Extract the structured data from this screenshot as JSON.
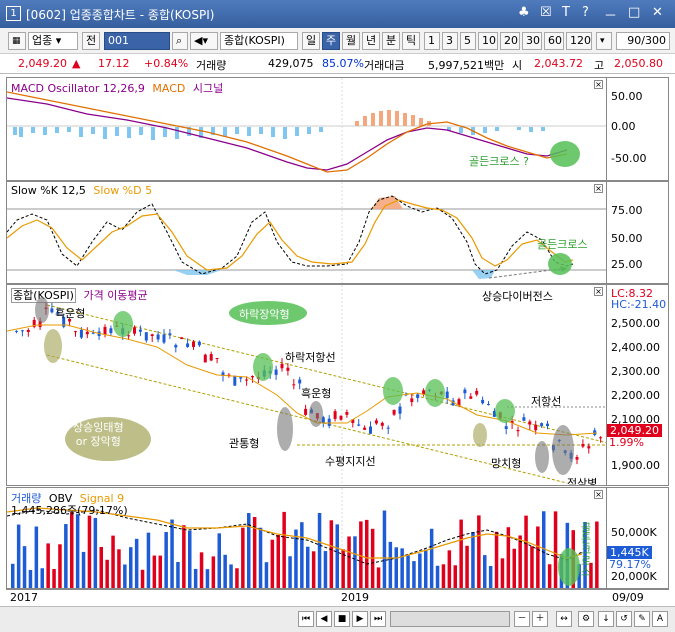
{
  "window": {
    "app_num": "1",
    "title": "[0602] 업종종합차트 - 종합(KOSPI)",
    "buttons": [
      "♣",
      "☒",
      "T",
      "?",
      "－",
      "□",
      "✕"
    ]
  },
  "toolbar": {
    "sector_select": "업종",
    "jeon_label": "전",
    "code_value": "001",
    "index_name": "종합(KOSPI)",
    "periods": [
      "일",
      "주",
      "월",
      "년",
      "분",
      "틱"
    ],
    "active_period": "주",
    "numbers": [
      "1",
      "3",
      "5",
      "10",
      "20",
      "30",
      "60",
      "120"
    ],
    "count": "90/300"
  },
  "quote": {
    "price": "2,049.20",
    "change": "17.12",
    "change_pct": "+0.84%",
    "volume_label": "거래량",
    "volume": "429,075",
    "volume_ratio": "85.07%",
    "amount_label": "거래대금",
    "amount": "5,997,521백만",
    "open_label": "시",
    "open": "2,043.72",
    "high_label": "고",
    "high": "2,050.80"
  },
  "macd": {
    "header_title": "MACD Oscillator 12,26,9",
    "header_macd": "MACD",
    "header_signal": "시그널",
    "axis": [
      "50.00",
      "0.00",
      "-50.00"
    ],
    "anno": "골든크로스 ?"
  },
  "stoch": {
    "header_k": "Slow %K 12,5",
    "header_d": "Slow %D 5",
    "axis": [
      "75.00",
      "50.00",
      "25.00"
    ],
    "anno1": "골든크로스",
    "anno2": "상승다이버전스"
  },
  "price": {
    "header_name": "종합(KOSPI)",
    "header_ma": "가격 이동평균",
    "lc": "LC:8.32",
    "hc": "HC:-21.40",
    "axis": [
      "2,500.00",
      "2,400.00",
      "2,300.00",
      "2,200.00",
      "2,100.00",
      "1,900.00"
    ],
    "last_price": "2,049.20",
    "last_pct": "1.99%",
    "annos": {
      "heuk1": "흑운형",
      "hwak": "하락장악형",
      "haresistance": "하락저항선",
      "heuk2": "흑운형",
      "imsin": "상승잉태형\nor 장악형",
      "gwantong": "관통형",
      "support": "수평지지선",
      "resistance": "저항선",
      "mangchi": "망치형",
      "jeoksam": "적삼병"
    }
  },
  "volume": {
    "header_vol": "거래량",
    "header_obv": "OBV",
    "header_signal": "Signal 9",
    "info": "1,445,286주(79,17%)",
    "axis": [
      "50,000K",
      "20,000K"
    ],
    "last_vol": "1,445K",
    "last_pct": "79.17%",
    "anno": "골든크로스"
  },
  "xaxis": {
    "labels": [
      "2017",
      "2019",
      "09/09"
    ]
  },
  "colors": {
    "up": "#e0001b",
    "down": "#1e5bd6",
    "ma": "#e89a00",
    "macd": "#8b008b",
    "signal": "#e07000",
    "hist": "#7fc6f0",
    "hist_pos": "#f4a77c",
    "green": "#55c055"
  }
}
